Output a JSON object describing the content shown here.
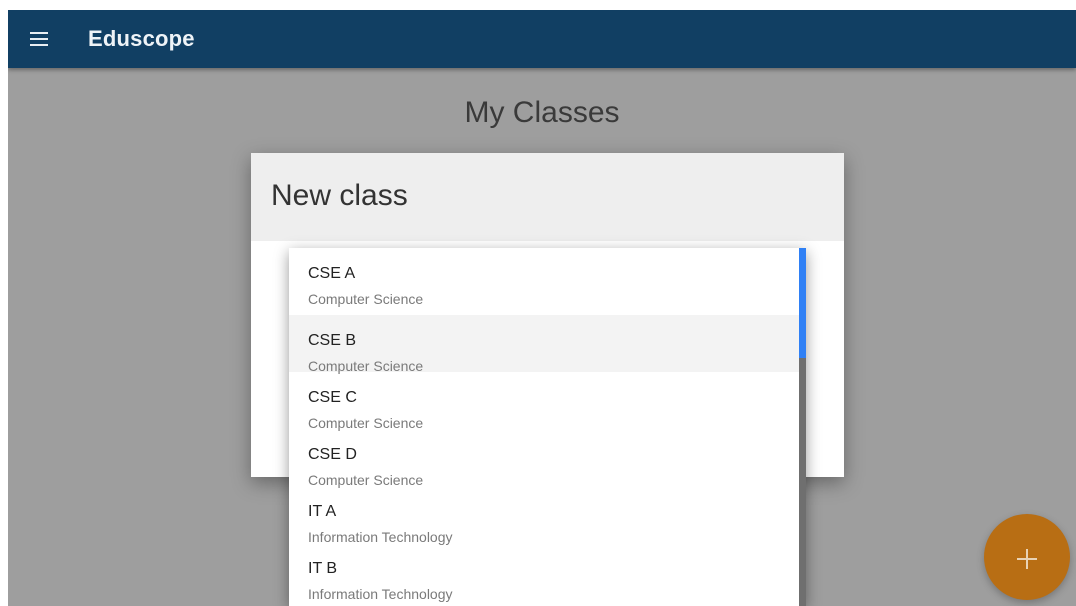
{
  "appbar": {
    "title": "Eduscope",
    "menu_icon": "hamburger-menu-icon",
    "background": "#113f63"
  },
  "page": {
    "title": "My Classes"
  },
  "dialog": {
    "title": "New class"
  },
  "class_dropdown": {
    "options": [
      {
        "name": "CSE A",
        "department": "Computer Science"
      },
      {
        "name": "CSE B",
        "department": "Computer Science"
      },
      {
        "name": "CSE C",
        "department": "Computer Science"
      },
      {
        "name": "CSE D",
        "department": "Computer Science"
      },
      {
        "name": "IT A",
        "department": "Information Technology"
      },
      {
        "name": "IT B",
        "department": "Information Technology"
      }
    ],
    "highlighted_option": "CSE B",
    "scrollbar_color": "#2f80f5"
  },
  "fab": {
    "icon": "plus-icon",
    "color": "#b86e14"
  }
}
